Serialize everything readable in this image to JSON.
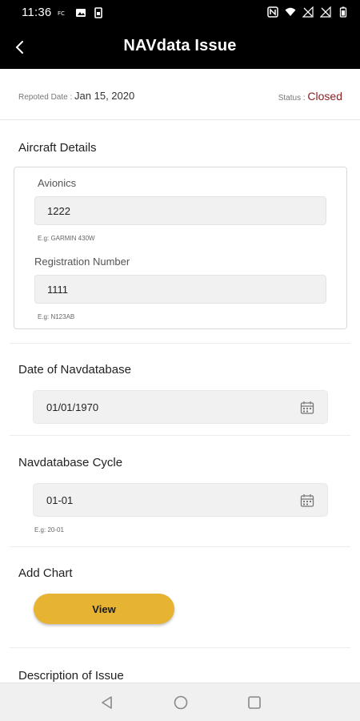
{
  "status_bar": {
    "time": "11:36",
    "left_icons": [
      "nfc-icon",
      "image-icon",
      "sim-icon"
    ],
    "right_icons": [
      "nfc-n-icon",
      "wifi-icon",
      "signal-off-icon",
      "signal-off-icon",
      "battery-icon"
    ]
  },
  "header": {
    "title": "NAVdata Issue",
    "back_icon": "back-arrow-icon"
  },
  "report": {
    "date_label": "Repoted Date : ",
    "date_value": "Jan 15, 2020",
    "status_label": "Status : ",
    "status_value": "Closed",
    "status_color": "#8a1f24"
  },
  "aircraft": {
    "section_title": "Aircraft Details",
    "avionics_label": "Avionics",
    "avionics_value": "1222",
    "avionics_hint": "E.g: GARMIN 430W",
    "registration_label": "Registration Number",
    "registration_value": "1111",
    "registration_hint": "E.g: N123AB"
  },
  "navdatabase_date": {
    "section_title": "Date of Navdatabase",
    "value": "01/01/1970"
  },
  "navdatabase_cycle": {
    "section_title": "Navdatabase Cycle",
    "value": "01-01",
    "hint": "E.g: 20-01"
  },
  "chart": {
    "section_title": "Add Chart",
    "button_label": "View",
    "button_color": "#e6b333"
  },
  "description": {
    "section_title": "Description of Issue"
  },
  "nav": {
    "back_icon": "nav-back-icon",
    "home_icon": "nav-home-icon",
    "recents_icon": "nav-recents-icon"
  }
}
